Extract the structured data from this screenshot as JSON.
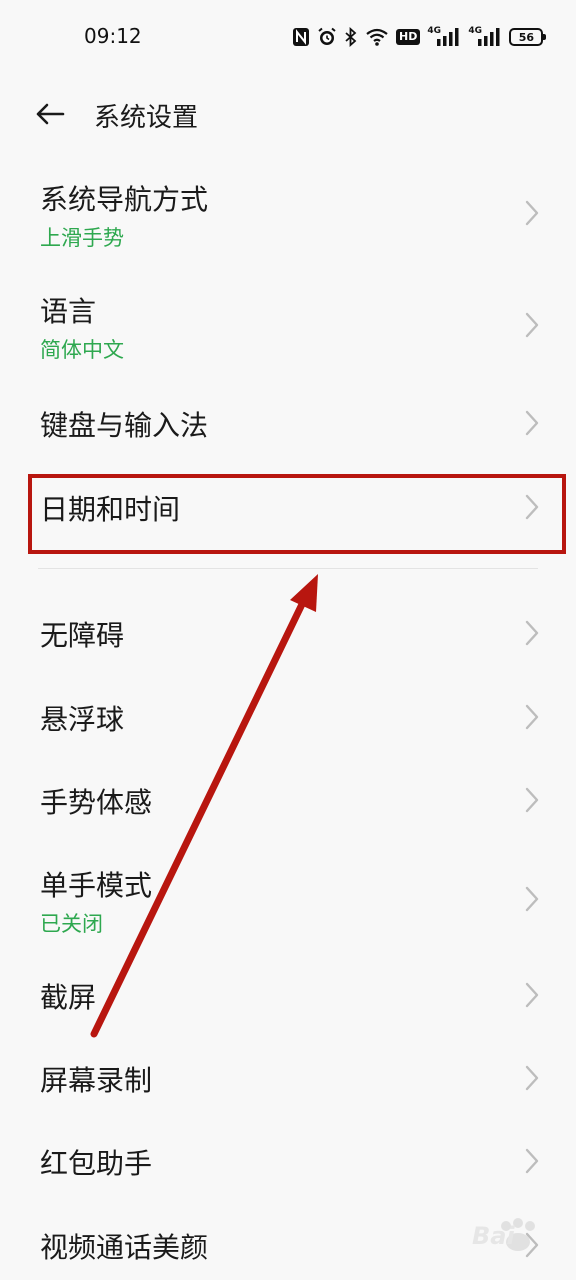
{
  "status_bar": {
    "time": "09:12",
    "hd": "HD",
    "network_1": "4G",
    "network_2": "4G",
    "battery": "56",
    "icons": [
      "nfc-icon",
      "alarm-icon",
      "bluetooth-icon",
      "wifi-icon",
      "hd-icon",
      "signal-icon",
      "signal-icon",
      "battery-icon"
    ]
  },
  "header": {
    "back_icon": "back-arrow-icon",
    "title": "系统设置"
  },
  "settings": {
    "items": [
      {
        "label": "系统导航方式",
        "sub": "上滑手势"
      },
      {
        "label": "语言",
        "sub": "简体中文"
      },
      {
        "label": "键盘与输入法",
        "sub": ""
      },
      {
        "label": "日期和时间",
        "sub": ""
      },
      {
        "label": "无障碍",
        "sub": ""
      },
      {
        "label": "悬浮球",
        "sub": ""
      },
      {
        "label": "手势体感",
        "sub": ""
      },
      {
        "label": "单手模式",
        "sub": "已关闭"
      },
      {
        "label": "截屏",
        "sub": ""
      },
      {
        "label": "屏幕录制",
        "sub": ""
      },
      {
        "label": "红包助手",
        "sub": ""
      },
      {
        "label": "视频通话美颜",
        "sub": ""
      }
    ]
  },
  "colors": {
    "background": "#f8f8f8",
    "subtitle_green": "#2ea84f",
    "annotation_red": "#b8160f",
    "chevron_gray": "#bdbdbd"
  },
  "watermark": "Bai"
}
